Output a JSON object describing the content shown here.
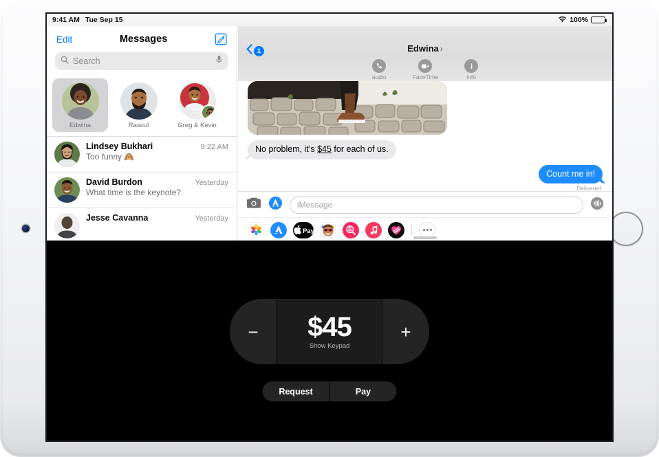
{
  "status_bar": {
    "time": "9:41 AM",
    "date": "Tue Sep 15",
    "wifi_icon": "wifi-icon",
    "battery_percent": "100%",
    "battery_icon": "battery-full-icon"
  },
  "sidebar": {
    "edit_label": "Edit",
    "title": "Messages",
    "compose_icon": "compose-icon",
    "search": {
      "placeholder": "Search",
      "search_icon": "search-icon",
      "mic_icon": "microphone-icon"
    },
    "pinned": [
      {
        "name": "Edwina",
        "selected": true
      },
      {
        "name": "Rasoul",
        "selected": false
      },
      {
        "name": "Greg & Kevin",
        "selected": false
      }
    ],
    "conversations": [
      {
        "name": "Lindsey Bukhari",
        "time": "9:22 AM",
        "preview": "Too funny 🙈"
      },
      {
        "name": "David Burdon",
        "time": "Yesterday",
        "preview": "What time is the keynote?"
      },
      {
        "name": "Jesse Cavanna",
        "time": "Yesterday",
        "preview": ""
      }
    ]
  },
  "conversation": {
    "back_badge": "1",
    "title": "Edwina",
    "title_chevron": "›",
    "actions": [
      {
        "label": "audio",
        "icon": "phone-icon"
      },
      {
        "label": "FaceTime",
        "icon": "video-camera-icon"
      },
      {
        "label": "info",
        "icon": "info-icon"
      }
    ],
    "attachment": {
      "name": "photo-attachment"
    },
    "messages": [
      {
        "direction": "in",
        "text_before": "No problem, it’s ",
        "link": "$45",
        "text_after": " for each of us."
      },
      {
        "direction": "out",
        "text": "Count me in!",
        "status": "Delivered"
      }
    ],
    "input": {
      "camera_icon": "camera-icon",
      "appstore_icon": "app-store-icon",
      "placeholder": "iMessage",
      "audio_icon": "audio-waveform-icon"
    },
    "app_drawer": [
      {
        "name": "photos-app-icon"
      },
      {
        "name": "app-store-app-icon"
      },
      {
        "name": "apple-pay-app-icon",
        "label": "Pay"
      },
      {
        "name": "memoji-app-icon"
      },
      {
        "name": "images-search-app-icon"
      },
      {
        "name": "music-app-icon"
      },
      {
        "name": "digital-touch-app-icon"
      }
    ],
    "more_icon": "more-options-icon"
  },
  "apple_pay": {
    "minus_label": "−",
    "plus_label": "+",
    "amount": "$45",
    "keypad_label": "Show Keypad",
    "request_label": "Request",
    "pay_label": "Pay"
  },
  "colors": {
    "accent_blue": "#007aff",
    "bubble_blue": "#1d8cfe",
    "bubble_gray": "#e9e9eb",
    "pay_black": "#000000"
  }
}
